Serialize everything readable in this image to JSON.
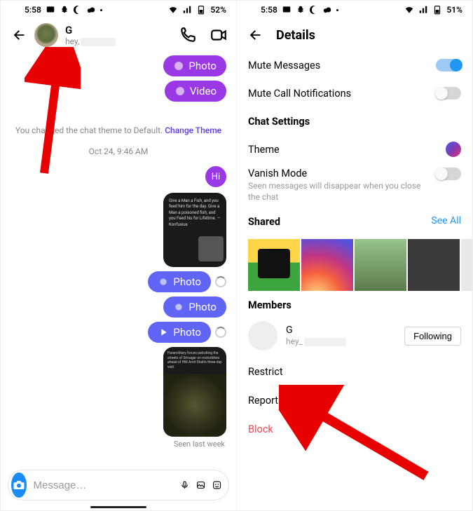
{
  "left": {
    "status": {
      "time": "5:58",
      "battery": "52%"
    },
    "chat": {
      "user_name": "G",
      "user_sub_prefix": "hey,",
      "pill_photo": "Photo",
      "pill_video": "Video",
      "sys_text": "You changed the chat theme to Default. ",
      "sys_link": "Change Theme",
      "timestamp": "Oct 24, 9:46 AM",
      "hi": "Hi",
      "quote": "Give a Man a Fish, and you feed him for the day. Give a Man a poisoned fish, and you Feed his for Lifetime.\n—Konfusius",
      "photo_pill": "Photo",
      "seen": "Seen last week",
      "composer_placeholder": "Message…"
    }
  },
  "right": {
    "status": {
      "time": "5:58",
      "battery": "51%"
    },
    "title": "Details",
    "rows": {
      "mute_messages": "Mute Messages",
      "mute_calls": "Mute Call Notifications",
      "chat_settings": "Chat Settings",
      "theme": "Theme",
      "vanish": "Vanish Mode",
      "vanish_sub": "Seen messages will disappear when you close the chat",
      "shared": "Shared",
      "see_all": "See All",
      "members": "Members",
      "member_name": "G",
      "member_sub_prefix": "hey_",
      "following": "Following",
      "restrict": "Restrict",
      "report": "Report",
      "block": "Block"
    }
  }
}
